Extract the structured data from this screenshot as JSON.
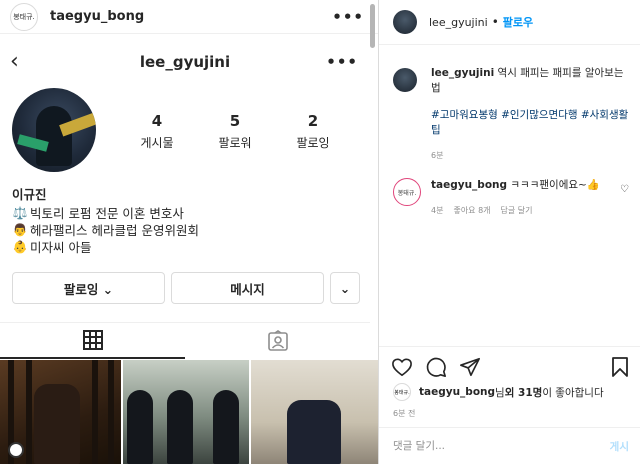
{
  "top": {
    "avatar_text": "봉태규.",
    "username": "taegyu_bong",
    "more": "•••"
  },
  "profile": {
    "back": "‹",
    "username": "lee_gyujini",
    "more": "•••",
    "stats": [
      {
        "num": "4",
        "label": "게시물"
      },
      {
        "num": "5",
        "label": "팔로워"
      },
      {
        "num": "2",
        "label": "팔로잉"
      }
    ],
    "name": "이규진",
    "bio": [
      {
        "emoji": "⚖️",
        "text": "빅토리 로펌 전문 이혼 변호사"
      },
      {
        "emoji": "👨",
        "text": "헤라팰리스 헤라클럽 운영위원회"
      },
      {
        "emoji": "👶",
        "text": "미자씨 아들"
      }
    ],
    "buttons": {
      "follow": "팔로잉 ⌄",
      "message": "메시지",
      "more": "⌄"
    }
  },
  "tabs": {
    "grid_icon": "grid-icon",
    "tagged_icon": "tagged-icon"
  },
  "post": {
    "header_user": "lee_gyujini",
    "header_dot": "•",
    "header_follow": "팔로우",
    "caption_user": "lee_gyujini",
    "caption_text": "역시 패피는 패피를 알아보는 법",
    "tags": "#고마워요봉형 #인기많으면다행 #사회생활팁",
    "time": "6분",
    "comment": {
      "avatar_text": "봉태규.",
      "user": "taegyu_bong",
      "text": "ㅋㅋㅋ팬이에요~👍",
      "time": "4분",
      "likes": "좋아요 8개",
      "reply": "답글 달기"
    },
    "likes": {
      "avatar_text": "봉태규.",
      "user": "taegyu_bong",
      "prefix": "님 ",
      "count": "외 31명",
      "suffix": "이 좋아합니다"
    },
    "ago": "6분 전",
    "input_placeholder": "댓글 달기...",
    "post_button": "게시"
  },
  "colors": {
    "accent": "#0095f6",
    "link": "#00376b",
    "muted": "#8e8e8e",
    "ring": "#e0457b"
  }
}
